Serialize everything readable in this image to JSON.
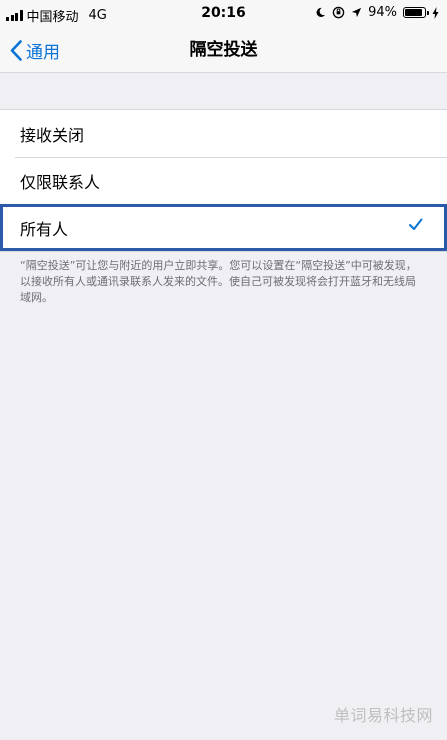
{
  "status_bar": {
    "carrier": "中国移动",
    "network": "4G",
    "time": "20:16",
    "battery_percent": "94%",
    "battery_level": 0.94,
    "icons": [
      "moon-icon",
      "orientation-lock-icon",
      "location-icon",
      "charging-bolt-icon"
    ]
  },
  "nav": {
    "back_label": "通用",
    "title": "隔空投送"
  },
  "options": [
    {
      "label": "接收关闭",
      "selected": false
    },
    {
      "label": "仅限联系人",
      "selected": false
    },
    {
      "label": "所有人",
      "selected": true
    }
  ],
  "footnote": "“隔空投送”可让您与附近的用户立即共享。您可以设置在“隔空投送”中可被发现，以接收所有人或通讯录联系人发来的文件。使自己可被发现将会打开蓝牙和无线局域网。",
  "watermark": "单词易科技网",
  "colors": {
    "accent": "#0a74d6",
    "highlight_box": "#2c59a9",
    "background": "#efeff4"
  }
}
